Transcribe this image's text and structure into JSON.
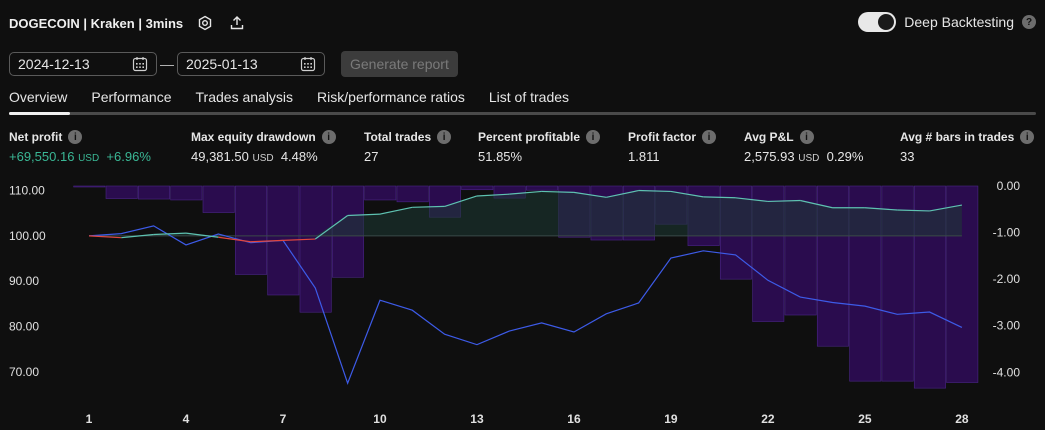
{
  "header": {
    "title": "DOGECOIN | Kraken | 3mins",
    "deep_backtesting_label": "Deep Backtesting",
    "deep_backtesting_on": true,
    "help_glyph": "?"
  },
  "dates": {
    "start": "2024-12-13",
    "separator": "—",
    "end": "2025-01-13"
  },
  "generate_button": "Generate report",
  "tabs": [
    {
      "label": "Overview",
      "active": true
    },
    {
      "label": "Performance"
    },
    {
      "label": "Trades analysis"
    },
    {
      "label": "Risk/performance ratios"
    },
    {
      "label": "List of trades"
    }
  ],
  "stats": {
    "info_glyph": "i",
    "net_profit": {
      "label": "Net profit",
      "value": "+69,550.16",
      "unit": "USD",
      "percent": "+6.96%"
    },
    "max_drawdown": {
      "label": "Max equity drawdown",
      "value": "49,381.50",
      "unit": "USD",
      "percent": "4.48%"
    },
    "total_trades": {
      "label": "Total trades",
      "value": "27"
    },
    "percent_profitable": {
      "label": "Percent profitable",
      "value": "51.85%"
    },
    "profit_factor": {
      "label": "Profit factor",
      "value": "1.811"
    },
    "avg_pnl": {
      "label": "Avg P&L",
      "value": "2,575.93",
      "unit": "USD",
      "percent": "0.29%"
    },
    "avg_bars": {
      "label": "Avg # bars in trades",
      "value": "33"
    }
  },
  "colors": {
    "profit_green": "#3ab795",
    "equity_line": "#5ec2b1",
    "equity_loss_line": "#e0463e",
    "buyhold_line": "#3d5be8",
    "drawdown_bar": "#2a0c4e",
    "drawdown_edge": "#4a2686",
    "gain_area": "#1e3a34"
  },
  "chart_data": {
    "type": "line",
    "x": [
      1,
      2,
      3,
      4,
      5,
      6,
      7,
      8,
      9,
      10,
      11,
      12,
      13,
      14,
      15,
      16,
      17,
      18,
      19,
      20,
      21,
      22,
      23,
      24,
      25,
      26,
      27,
      28
    ],
    "x_tick_labels": [
      "1",
      "4",
      "7",
      "10",
      "13",
      "16",
      "19",
      "22",
      "25",
      "28"
    ],
    "y_left_ticks": [
      "110.00",
      "100.00",
      "90.00",
      "80.00",
      "70.00"
    ],
    "y_right_ticks": [
      "0.00",
      "-1.00",
      "-2.00",
      "-3.00",
      "-4.00"
    ],
    "ylim_left": [
      66,
      111
    ],
    "ylim_right": [
      -4.38,
      0
    ],
    "series": [
      {
        "axis": "left",
        "values": [
          100,
          99.6,
          100.3,
          100.6,
          99.7,
          98.7,
          99,
          99.3,
          104.5,
          104.8,
          106.3,
          106.5,
          108.8,
          109.2,
          109.8,
          109.6,
          108.5,
          110,
          109.8,
          108.6,
          108.4,
          107.6,
          107.8,
          106.2,
          106.2,
          105.7,
          105.5,
          106.8
        ]
      },
      {
        "axis": "left",
        "values": [
          100,
          100.5,
          102.2,
          98,
          100.4,
          98.5,
          99,
          88.5,
          67.5,
          85.8,
          83.6,
          78.3,
          76,
          79,
          80.8,
          78.8,
          82.8,
          85.2,
          95.1,
          96.7,
          95.8,
          90.2,
          86.5,
          85.3,
          84.5,
          82.7,
          83.2,
          79.8
        ]
      },
      {
        "axis": "right",
        "values": [
          -0.02,
          -0.27,
          -0.28,
          -0.3,
          -0.57,
          -1.9,
          -2.34,
          -2.71,
          -1.96,
          -0.3,
          -0.34,
          -0.67,
          -0.08,
          -0.26,
          -0.09,
          -1.1,
          -1.16,
          -1.16,
          -0.82,
          -1.28,
          -2.0,
          -2.91,
          -2.77,
          -3.44,
          -4.19,
          -4.19,
          -4.34,
          -4.22
        ]
      }
    ],
    "grid": true
  }
}
